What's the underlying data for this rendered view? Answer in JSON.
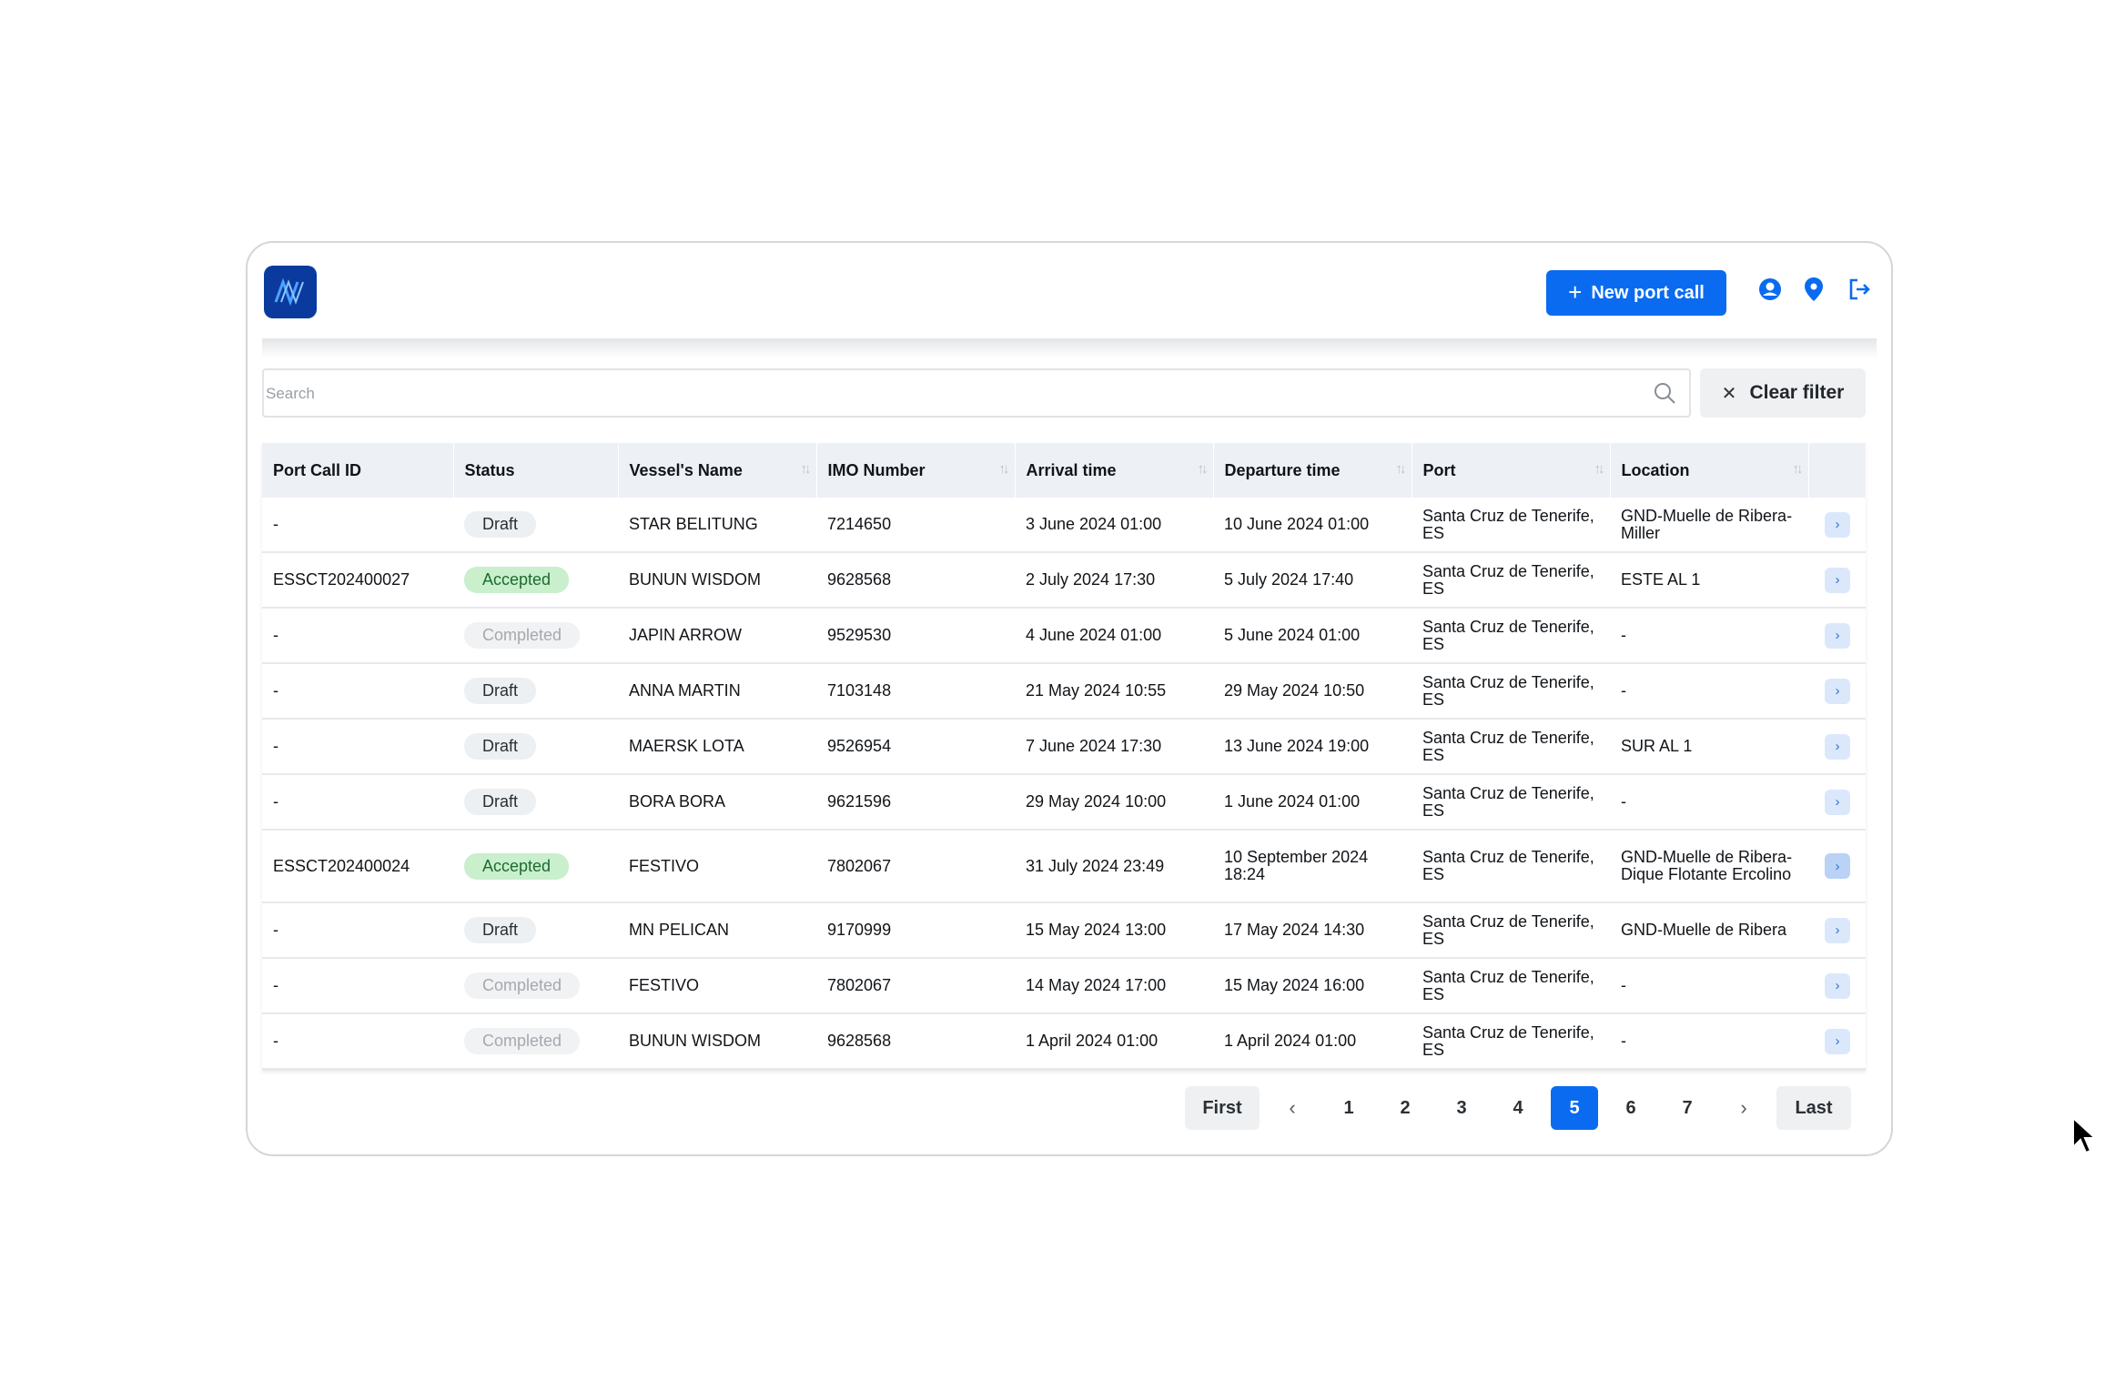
{
  "header": {
    "new_port_call_label": "New port call",
    "accent_color": "#0a6bf0",
    "icons": [
      "user-icon",
      "location-pin-icon",
      "logout-icon"
    ]
  },
  "search": {
    "placeholder": "Search"
  },
  "filter": {
    "clear_label": "Clear filter"
  },
  "table": {
    "columns": [
      "Port Call ID",
      "Status",
      "Vessel's Name",
      "IMO Number",
      "Arrival time",
      "Departure time",
      "Port",
      "Location"
    ],
    "rows": [
      {
        "id": "-",
        "status": "Draft",
        "vessel": "STAR BELITUNG",
        "imo": "7214650",
        "arrival": "3 June 2024 01:00",
        "departure": "10 June 2024 01:00",
        "port": "Santa Cruz de Tenerife, ES",
        "location": "GND-Muelle de Ribera-Miller"
      },
      {
        "id": "ESSCT202400027",
        "status": "Accepted",
        "vessel": "BUNUN WISDOM",
        "imo": "9628568",
        "arrival": "2 July 2024 17:30",
        "departure": "5 July 2024 17:40",
        "port": "Santa Cruz de Tenerife, ES",
        "location": "ESTE AL 1"
      },
      {
        "id": "-",
        "status": "Completed",
        "vessel": "JAPIN ARROW",
        "imo": "9529530",
        "arrival": "4 June 2024 01:00",
        "departure": "5 June 2024 01:00",
        "port": "Santa Cruz de Tenerife, ES",
        "location": "-"
      },
      {
        "id": "-",
        "status": "Draft",
        "vessel": "ANNA MARTIN",
        "imo": "7103148",
        "arrival": "21 May 2024 10:55",
        "departure": "29 May 2024 10:50",
        "port": "Santa Cruz de Tenerife, ES",
        "location": "-"
      },
      {
        "id": "-",
        "status": "Draft",
        "vessel": "MAERSK LOTA",
        "imo": "9526954",
        "arrival": "7 June 2024 17:30",
        "departure": "13 June 2024 19:00",
        "port": "Santa Cruz de Tenerife, ES",
        "location": "SUR AL 1"
      },
      {
        "id": "-",
        "status": "Draft",
        "vessel": "BORA BORA",
        "imo": "9621596",
        "arrival": "29 May 2024 10:00",
        "departure": "1 June 2024 01:00",
        "port": "Santa Cruz de Tenerife, ES",
        "location": "-"
      },
      {
        "id": "ESSCT202400024",
        "status": "Accepted",
        "vessel": "FESTIVO",
        "imo": "7802067",
        "arrival": "31 July 2024 23:49",
        "departure": "10 September 2024 18:24",
        "port": "Santa Cruz de Tenerife, ES",
        "location": "GND-Muelle de Ribera-Dique Flotante Ercolino"
      },
      {
        "id": "-",
        "status": "Draft",
        "vessel": "MN PELICAN",
        "imo": "9170999",
        "arrival": "15 May 2024 13:00",
        "departure": "17 May 2024 14:30",
        "port": "Santa Cruz de Tenerife, ES",
        "location": "GND-Muelle de Ribera"
      },
      {
        "id": "-",
        "status": "Completed",
        "vessel": "FESTIVO",
        "imo": "7802067",
        "arrival": "14 May 2024 17:00",
        "departure": "15 May 2024 16:00",
        "port": "Santa Cruz de Tenerife, ES",
        "location": "-"
      },
      {
        "id": "-",
        "status": "Completed",
        "vessel": "BUNUN WISDOM",
        "imo": "9628568",
        "arrival": "1 April 2024 01:00",
        "departure": "1 April 2024 01:00",
        "port": "Santa Cruz de Tenerife, ES",
        "location": "-"
      }
    ]
  },
  "pagination": {
    "first_label": "First",
    "last_label": "Last",
    "pages": [
      "1",
      "2",
      "3",
      "4",
      "5",
      "6",
      "7"
    ],
    "current_page": "5"
  }
}
